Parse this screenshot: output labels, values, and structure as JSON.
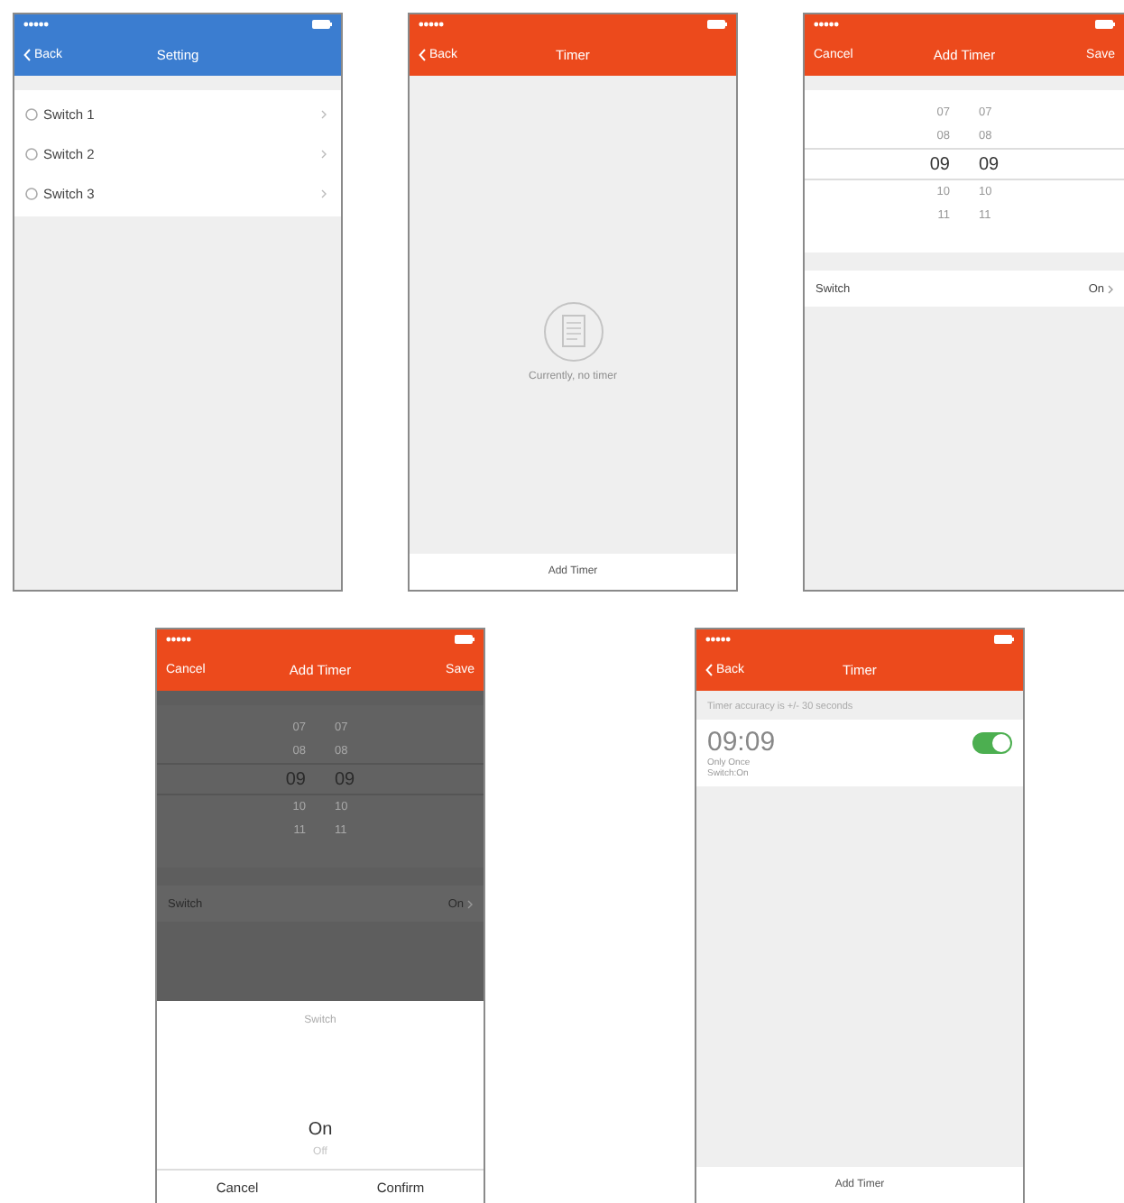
{
  "screens": [
    {
      "kind": "list",
      "header": {
        "color": "#3b7dd0",
        "left": "Back",
        "title": "Setting"
      },
      "items": [
        "Switch 1",
        "Switch 2",
        "Switch 3"
      ]
    },
    {
      "kind": "empty",
      "header": {
        "color": "#ec4a1c",
        "left": "Back",
        "title": "Timer"
      },
      "empty_text": "Currently, no timer",
      "footer": "Add Timer"
    },
    {
      "kind": "picker",
      "header": {
        "color": "#ec4a1c",
        "left": "Cancel",
        "title": "Add Timer",
        "right": "Save"
      },
      "dimmed": false,
      "picker": [
        {
          "hour": "07",
          "minute": "07",
          "selected": false
        },
        {
          "hour": "08",
          "minute": "08",
          "selected": false
        },
        {
          "hour": "09",
          "minute": "09",
          "selected": true
        },
        {
          "hour": "10",
          "minute": "10",
          "selected": false
        },
        {
          "hour": "11",
          "minute": "11",
          "selected": false
        }
      ],
      "setting": {
        "label": "Switch",
        "value": "On"
      }
    },
    {
      "kind": "picker",
      "header": {
        "color": "#ec4a1c",
        "left": "Cancel",
        "title": "Add Timer",
        "right": "Save"
      },
      "dimmed": true,
      "picker": [
        {
          "hour": "07",
          "minute": "07",
          "selected": false
        },
        {
          "hour": "08",
          "minute": "08",
          "selected": false
        },
        {
          "hour": "09",
          "minute": "09",
          "selected": true
        },
        {
          "hour": "10",
          "minute": "10",
          "selected": false
        },
        {
          "hour": "11",
          "minute": "11",
          "selected": false
        }
      ],
      "setting": {
        "label": "Switch",
        "value": "On"
      },
      "sheet": {
        "title": "Switch",
        "options": [
          {
            "label": "On",
            "selected": true
          },
          {
            "label": "Off",
            "selected": false
          }
        ],
        "buttons": [
          "Cancel",
          "Confirm"
        ]
      }
    },
    {
      "kind": "timers",
      "header": {
        "color": "#ec4a1c",
        "left": "Back",
        "title": "Timer"
      },
      "note": "Timer accuracy is +/- 30 seconds",
      "timers": [
        {
          "time": "09:09",
          "repeat": "Only Once",
          "action": "Switch:On",
          "on": true
        }
      ],
      "footer": "Add Timer"
    }
  ]
}
